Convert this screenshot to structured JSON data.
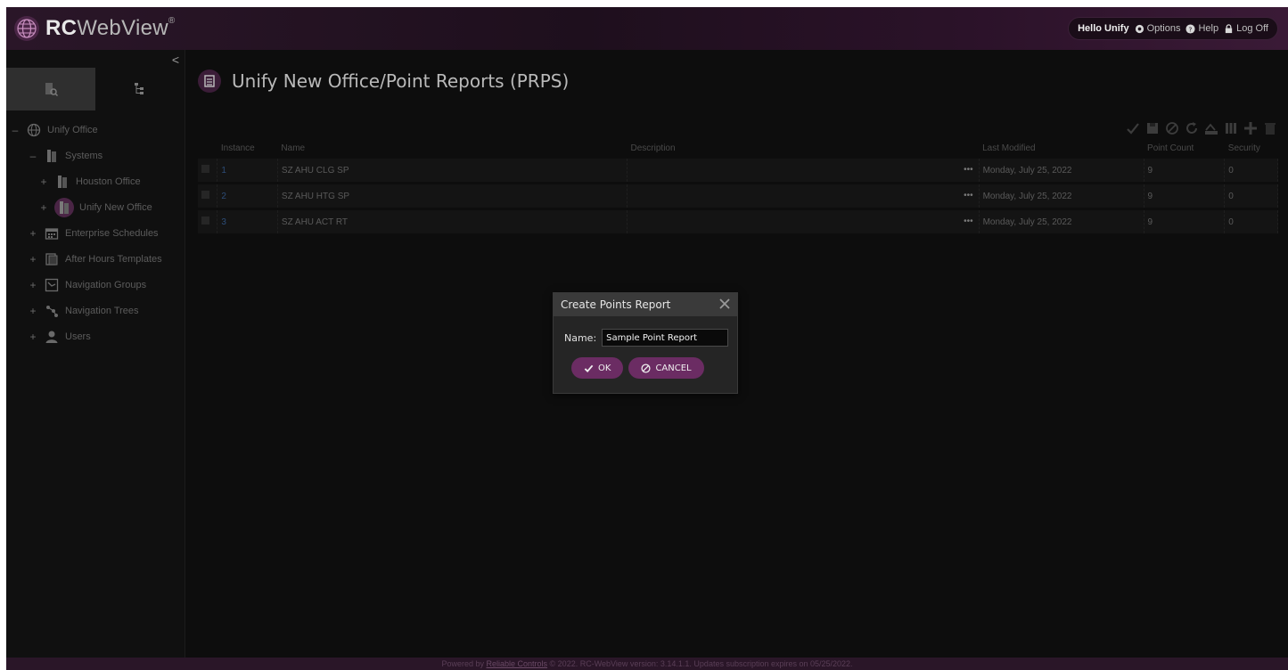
{
  "header": {
    "logo_rc": "RC",
    "logo_webview": "WebView",
    "logo_reg": "®",
    "greeting": "Hello Unify",
    "options": "Options",
    "help": "Help",
    "logoff": "Log Off"
  },
  "sidebar": {
    "collapse_glyph": "<",
    "tree": [
      {
        "toggle": "–",
        "label": "Unify Office"
      },
      {
        "toggle": "–",
        "label": "Systems"
      },
      {
        "toggle": "+",
        "label": "Houston Office"
      },
      {
        "toggle": "+",
        "label": "Unify New Office"
      },
      {
        "toggle": "+",
        "label": "Enterprise Schedules"
      },
      {
        "toggle": "+",
        "label": "After Hours Templates"
      },
      {
        "toggle": "+",
        "label": "Navigation Groups"
      },
      {
        "toggle": "+",
        "label": "Navigation Trees"
      },
      {
        "toggle": "+",
        "label": "Users"
      }
    ]
  },
  "main": {
    "title": "Unify New Office/Point Reports (PRPS)",
    "columns": [
      "Instance",
      "Name",
      "Description",
      "Last Modified",
      "Point Count",
      "Security"
    ],
    "rows": [
      {
        "instance": "1",
        "name": "SZ AHU CLG SP",
        "description": "",
        "modified": "Monday, July 25, 2022",
        "count": "9",
        "security": "0"
      },
      {
        "instance": "2",
        "name": "SZ AHU HTG SP",
        "description": "",
        "modified": "Monday, July 25, 2022",
        "count": "9",
        "security": "0"
      },
      {
        "instance": "3",
        "name": "SZ AHU ACT RT",
        "description": "",
        "modified": "Monday, July 25, 2022",
        "count": "9",
        "security": "0"
      }
    ],
    "row_dots": "•••"
  },
  "dialog": {
    "title": "Create Points Report",
    "name_label": "Name:",
    "name_value": "Sample Point Report",
    "ok_label": "OK",
    "cancel_label": "CANCEL"
  },
  "footer": {
    "powered_by": "Powered by",
    "company": "Reliable Controls",
    "rest": "© 2022. RC-WebView version: 3.14.1.1. Updates subscription expires on 05/25/2022."
  },
  "colors": {
    "accent": "#6b2c63",
    "header_bg": "#2a1628",
    "background": "#0c0c0c"
  }
}
